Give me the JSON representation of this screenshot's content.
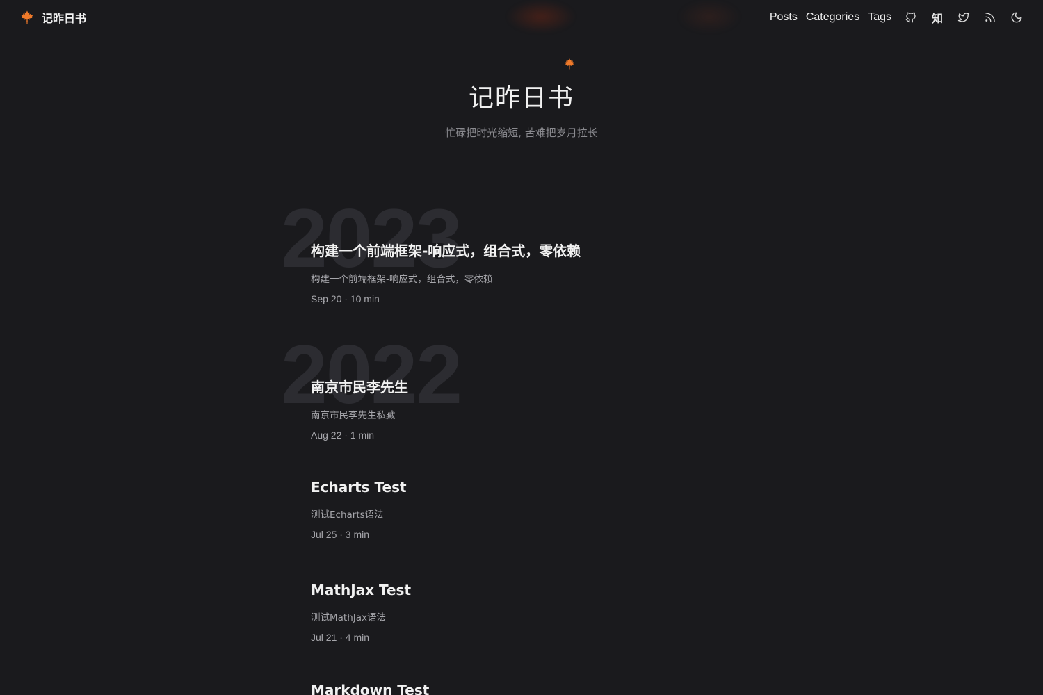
{
  "header": {
    "brand": "记昨日书",
    "nav": [
      "Posts",
      "Categories",
      "Tags"
    ],
    "icons": [
      "github-icon",
      "zhihu-icon",
      "twitter-icon",
      "rss-icon",
      "moon-icon"
    ],
    "zhihu_label": "知"
  },
  "hero": {
    "title": "记昨日书",
    "subtitle": "忙碌把时光缩短, 苦难把岁月拉长"
  },
  "years": [
    "2023",
    "2022"
  ],
  "posts": [
    {
      "title": "构建一个前端框架-响应式，组合式，零依赖",
      "desc": "构建一个前端框架-响应式，组合式，零依赖",
      "meta": "Sep 20 · 10 min"
    },
    {
      "title": "南京市民李先生",
      "desc": "南京市民李先生私藏",
      "meta": "Aug 22 · 1 min"
    },
    {
      "title": "Echarts Test",
      "desc": "测试Echarts语法",
      "meta": "Jul 25 · 3 min"
    },
    {
      "title": "MathJax Test",
      "desc": "测试MathJax语法",
      "meta": "Jul 21 · 4 min"
    },
    {
      "title": "Markdown Test",
      "desc": "",
      "meta": ""
    }
  ],
  "colors": {
    "background": "#1a1a1d",
    "accent": "#f07a2a",
    "year": "#2c2c31"
  }
}
